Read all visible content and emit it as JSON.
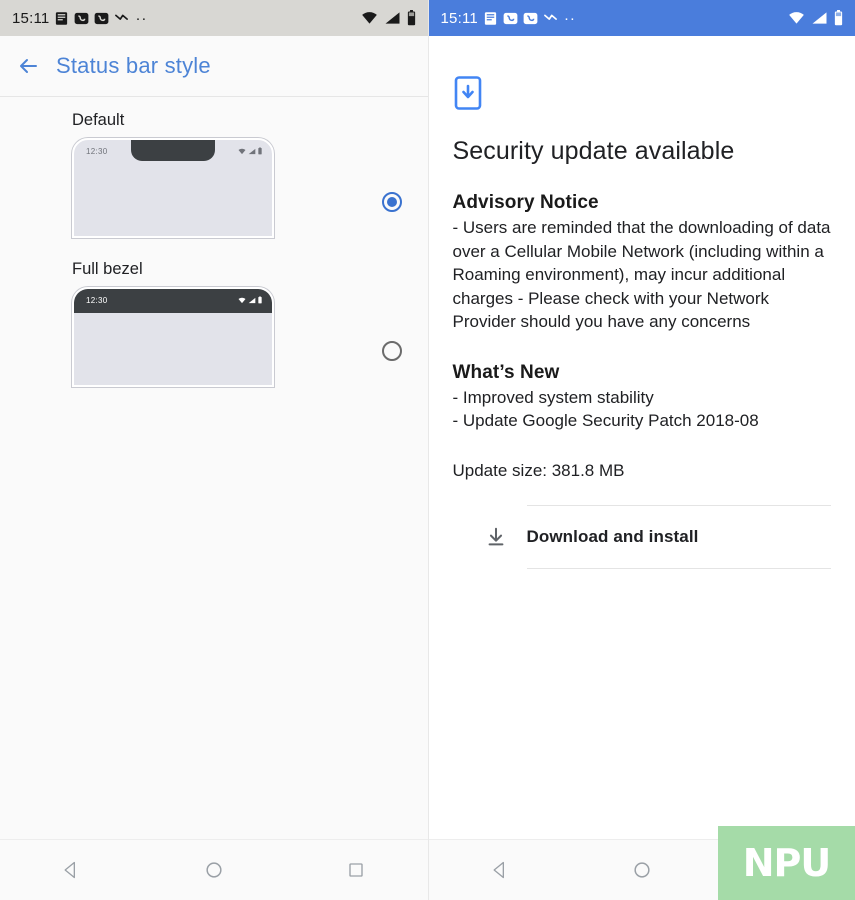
{
  "left_phone": {
    "status_bar": {
      "time": "15:11",
      "notification_icons": [
        "sim-card-icon",
        "phone-call-icon",
        "phone-call-icon",
        "missed-call-icon"
      ],
      "overflow_dots": "··",
      "system_icons": [
        "wifi-icon",
        "signal-icon",
        "battery-icon"
      ]
    },
    "toolbar": {
      "back_label": "Back",
      "title": "Status bar style"
    },
    "options": [
      {
        "label": "Default",
        "preview_time": "12:30",
        "selected": true,
        "style": "notch"
      },
      {
        "label": "Full bezel",
        "preview_time": "12:30",
        "selected": false,
        "style": "bezel"
      }
    ],
    "nav_bar": {
      "back": "back-triangle",
      "home": "home-circle",
      "recents": "recents-square"
    }
  },
  "right_phone": {
    "status_bar": {
      "time": "15:11",
      "notification_icons": [
        "sim-card-icon",
        "phone-call-icon",
        "phone-call-icon",
        "missed-call-icon"
      ],
      "overflow_dots": "··",
      "system_icons": [
        "wifi-icon",
        "signal-icon",
        "battery-icon"
      ],
      "background_color": "#4a7ddc"
    },
    "update": {
      "icon": "system-update-icon",
      "title": "Security update available",
      "advisory_heading": "Advisory Notice",
      "advisory_body": "- Users are reminded that the downloading of data over a Cellular Mobile Network (including within a Roaming environment), may incur additional charges - Please check with your Network Provider should you have any concerns",
      "whats_new_heading": "What’s New",
      "whats_new_body": "- Improved system stability\n- Update Google Security Patch 2018-08",
      "update_size": "Update size: 381.8 MB",
      "action_label": "Download and install",
      "action_icon": "download-icon"
    },
    "nav_bar": {
      "back": "back-triangle",
      "home": "home-circle"
    }
  },
  "watermark": {
    "text": "NPU",
    "background_color": "#a5dba8"
  },
  "accent_color": "#4d84d6"
}
